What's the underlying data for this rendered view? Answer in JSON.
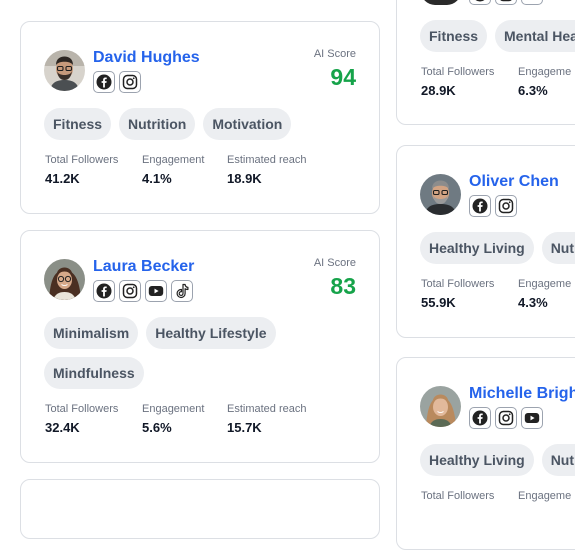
{
  "left_cards": [
    {
      "name": "David Hughes",
      "ai_label": "AI Score",
      "ai_score": "94",
      "socials": [
        "facebook-icon",
        "instagram-icon"
      ],
      "tags": [
        "Fitness",
        "Nutrition",
        "Motivation"
      ],
      "stats": [
        {
          "label": "Total Followers",
          "value": "41.2K"
        },
        {
          "label": "Engagement",
          "value": "4.1%"
        },
        {
          "label": "Estimated reach",
          "value": "18.9K"
        }
      ]
    },
    {
      "name": "Laura Becker",
      "ai_label": "AI Score",
      "ai_score": "83",
      "socials": [
        "facebook-icon",
        "instagram-icon",
        "youtube-icon",
        "tiktok-icon"
      ],
      "tags": [
        "Minimalism",
        "Healthy Lifestyle",
        "Mindfulness"
      ],
      "stats": [
        {
          "label": "Total Followers",
          "value": "32.4K"
        },
        {
          "label": "Engagement",
          "value": "5.6%"
        },
        {
          "label": "Estimated reach",
          "value": "15.7K"
        }
      ]
    }
  ],
  "right_cards": [
    {
      "tags": [
        "Fitness",
        "Mental Heal"
      ],
      "stats": [
        {
          "label": "Total Followers",
          "value": "28.9K"
        },
        {
          "label": "Engageme",
          "value": "6.3%"
        }
      ]
    },
    {
      "name": "Oliver Chen",
      "socials": [
        "facebook-icon",
        "instagram-icon"
      ],
      "tags": [
        "Healthy Living",
        "Nutrit"
      ],
      "stats": [
        {
          "label": "Total Followers",
          "value": "55.9K"
        },
        {
          "label": "Engageme",
          "value": "4.3%"
        }
      ]
    },
    {
      "name": "Michelle Bright",
      "socials": [
        "facebook-icon",
        "instagram-icon",
        "youtube-icon"
      ],
      "tags": [
        "Healthy Living",
        "Nutrit"
      ],
      "stats": [
        {
          "label": "Total Followers",
          "value": "",
          "label_only": true
        },
        {
          "label": "Engageme",
          "value": ""
        }
      ]
    }
  ],
  "colors": {
    "name_blue": "#2563eb",
    "score_green": "#16a34a",
    "tag_bg": "#eceef1",
    "card_border": "#dcdfe4"
  }
}
